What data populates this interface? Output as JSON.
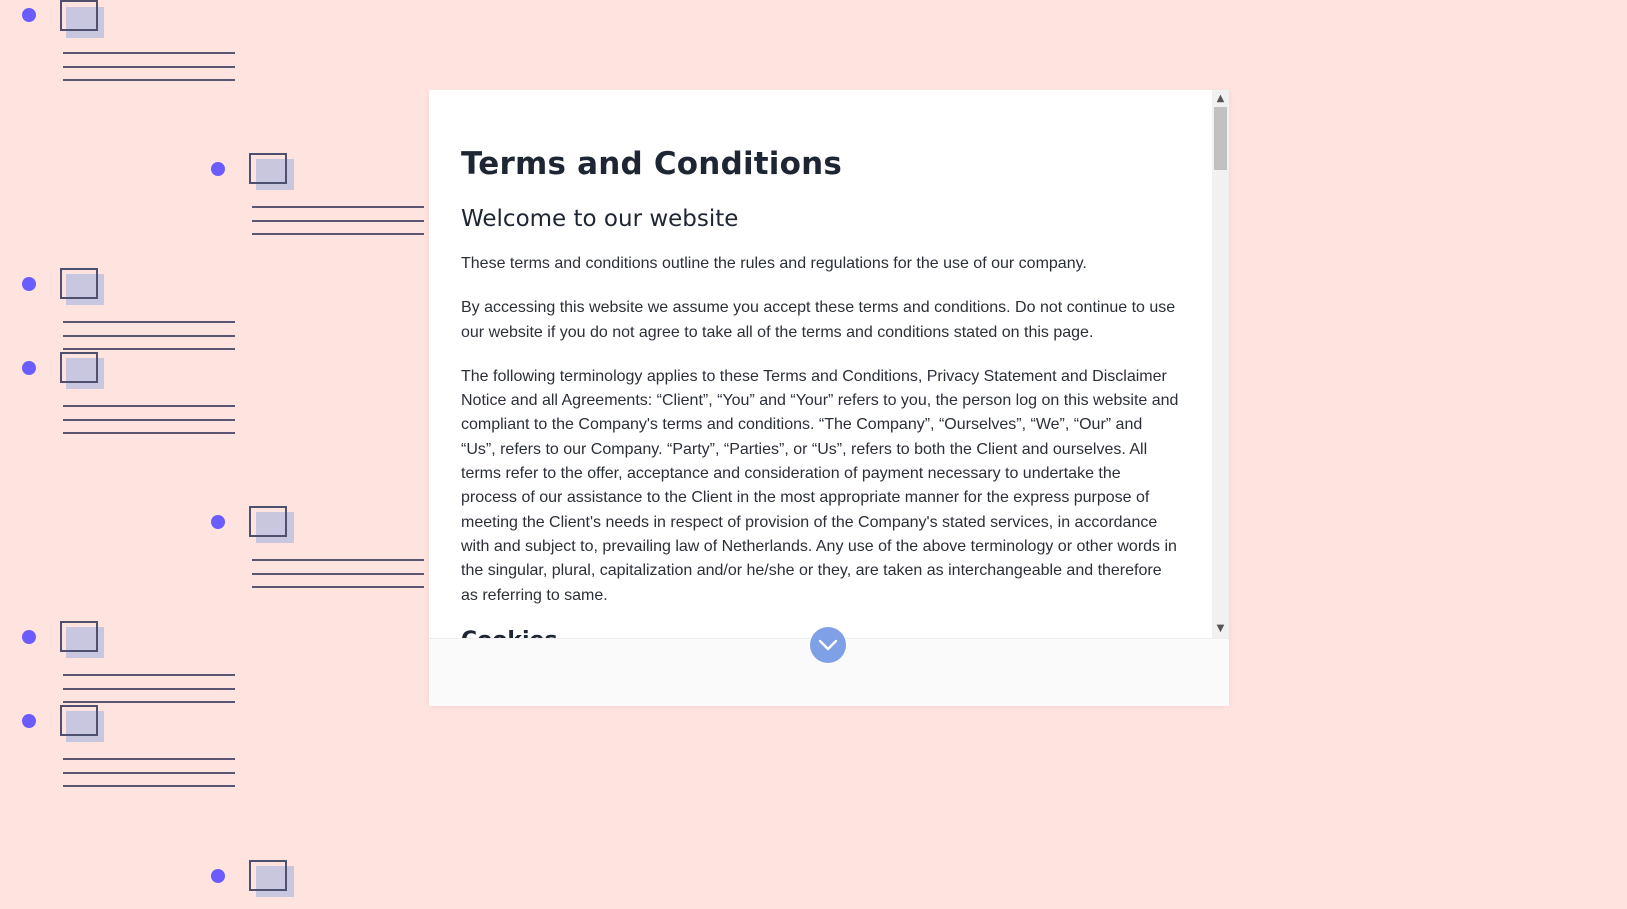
{
  "modal": {
    "title": "Terms and Conditions",
    "subtitle": "Welcome to our website",
    "paragraphs": [
      "These terms and conditions outline the rules and regulations for the use of our company.",
      "By accessing this website we assume you accept these terms and conditions. Do not continue to use our website if you do not agree to take all of the terms and conditions stated on this page.",
      "The following terminology applies to these Terms and Conditions, Privacy Statement and Disclaimer Notice and all Agreements: “Client”, “You” and “Your” refers to you, the person log on this website and compliant to the Company's terms and conditions. “The Company”, “Ourselves”, “We”, “Our” and “Us”, refers to our Company. “Party”, “Parties”, or “Us”, refers to both the Client and ourselves. All terms refer to the offer, acceptance and consideration of payment necessary to undertake the process of our assistance to the Client in the most appropriate manner for the express purpose of meeting the Client's needs in respect of provision of the Company's stated services, in accordance with and subject to, prevailing law of Netherlands. Any use of the above terminology or other words in the singular, plural, capitalization and/or he/she or they, are taken as interchangeable and therefore as referring to same."
    ],
    "next_section": "Cookies",
    "scroll_down_icon": "chevron-down-icon"
  },
  "colors": {
    "background": "#ffe3df",
    "accent_dot": "#6a5cff",
    "button": "#7f9fe6"
  }
}
